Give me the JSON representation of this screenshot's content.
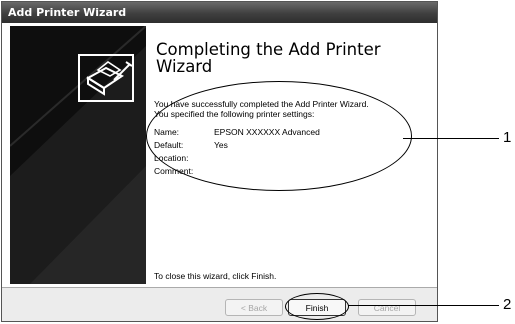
{
  "window": {
    "title": "Add Printer Wizard"
  },
  "heading": "Completing the Add Printer Wizard",
  "intro": {
    "line1": "You have successfully completed the Add Printer Wizard.",
    "line2": "You specified the following printer settings:"
  },
  "settings": [
    {
      "label": "Name:",
      "value": "EPSON XXXXXX  Advanced"
    },
    {
      "label": "Default:",
      "value": "Yes"
    },
    {
      "label": "Location:",
      "value": ""
    },
    {
      "label": "Comment:",
      "value": ""
    }
  ],
  "close_hint": "To close this wizard, click Finish.",
  "buttons": {
    "back": "< Back",
    "finish": "Finish",
    "cancel": "Cancel"
  },
  "callouts": {
    "one": "1",
    "two": "2"
  },
  "icons": {
    "wizard": "printer-wizard-icon"
  }
}
